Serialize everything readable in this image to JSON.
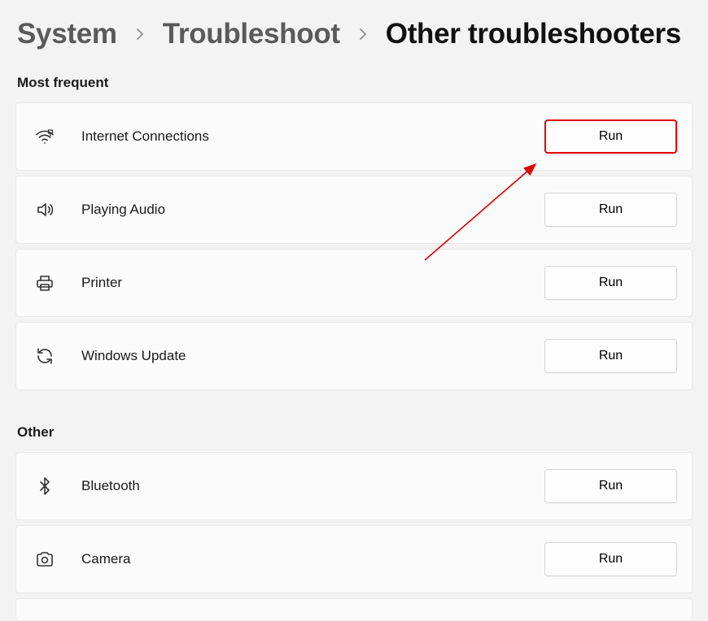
{
  "breadcrumb": {
    "level1": "System",
    "level2": "Troubleshoot",
    "current": "Other troubleshooters"
  },
  "sections": {
    "frequent_header": "Most frequent",
    "other_header": "Other"
  },
  "items": {
    "internet": {
      "label": "Internet Connections",
      "button": "Run"
    },
    "audio": {
      "label": "Playing Audio",
      "button": "Run"
    },
    "printer": {
      "label": "Printer",
      "button": "Run"
    },
    "update": {
      "label": "Windows Update",
      "button": "Run"
    },
    "bluetooth": {
      "label": "Bluetooth",
      "button": "Run"
    },
    "camera": {
      "label": "Camera",
      "button": "Run"
    }
  },
  "annotation": {
    "type": "highlight-arrow",
    "target": "run-button-internet",
    "color": "#df0000"
  }
}
